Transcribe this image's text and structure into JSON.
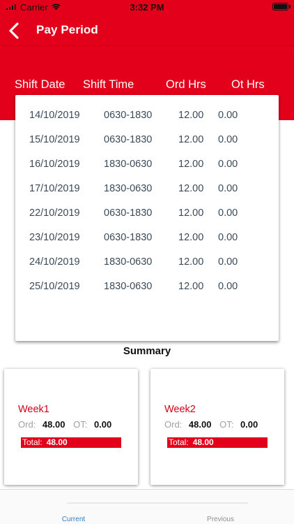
{
  "status_bar": {
    "carrier": "Carrier",
    "time": "3:32 PM",
    "icons": [
      "signal-icon",
      "wifi-icon",
      "battery-icon"
    ]
  },
  "nav": {
    "title": "Pay Period",
    "back_icon": "chevron-left-icon"
  },
  "colors": {
    "brand_red": "#e2001a",
    "row_text": "#3a4a58",
    "tab_active": "#2f7dc7"
  },
  "columns": {
    "date": "Shift Date",
    "time": "Shift Time",
    "ord": "Ord Hrs",
    "ot": "Ot Hrs"
  },
  "shifts": [
    {
      "date": "14/10/2019",
      "time": "0630-1830",
      "ord": "12.00",
      "ot": "0.00"
    },
    {
      "date": "15/10/2019",
      "time": "0630-1830",
      "ord": "12.00",
      "ot": "0.00"
    },
    {
      "date": "16/10/2019",
      "time": "1830-0630",
      "ord": "12.00",
      "ot": "0.00"
    },
    {
      "date": "17/10/2019",
      "time": "1830-0630",
      "ord": "12.00",
      "ot": "0.00"
    },
    {
      "date": "22/10/2019",
      "time": "0630-1830",
      "ord": "12.00",
      "ot": "0.00"
    },
    {
      "date": "23/10/2019",
      "time": "0630-1830",
      "ord": "12.00",
      "ot": "0.00"
    },
    {
      "date": "24/10/2019",
      "time": "1830-0630",
      "ord": "12.00",
      "ot": "0.00"
    },
    {
      "date": "25/10/2019",
      "time": "1830-0630",
      "ord": "12.00",
      "ot": "0.00"
    }
  ],
  "summary": {
    "title": "Summary",
    "weeks": [
      {
        "name": "Week1",
        "ord_label": "Ord:",
        "ord": "48.00",
        "ot_label": "OT:",
        "ot": "0.00",
        "total_label": "Total:",
        "total": "48.00"
      },
      {
        "name": "Week2",
        "ord_label": "Ord:",
        "ord": "48.00",
        "ot_label": "OT:",
        "ot": "0.00",
        "total_label": "Total:",
        "total": "48.00"
      }
    ]
  },
  "tabs": [
    {
      "label": "Current",
      "selected": true
    },
    {
      "label": "Previous",
      "selected": false
    }
  ]
}
